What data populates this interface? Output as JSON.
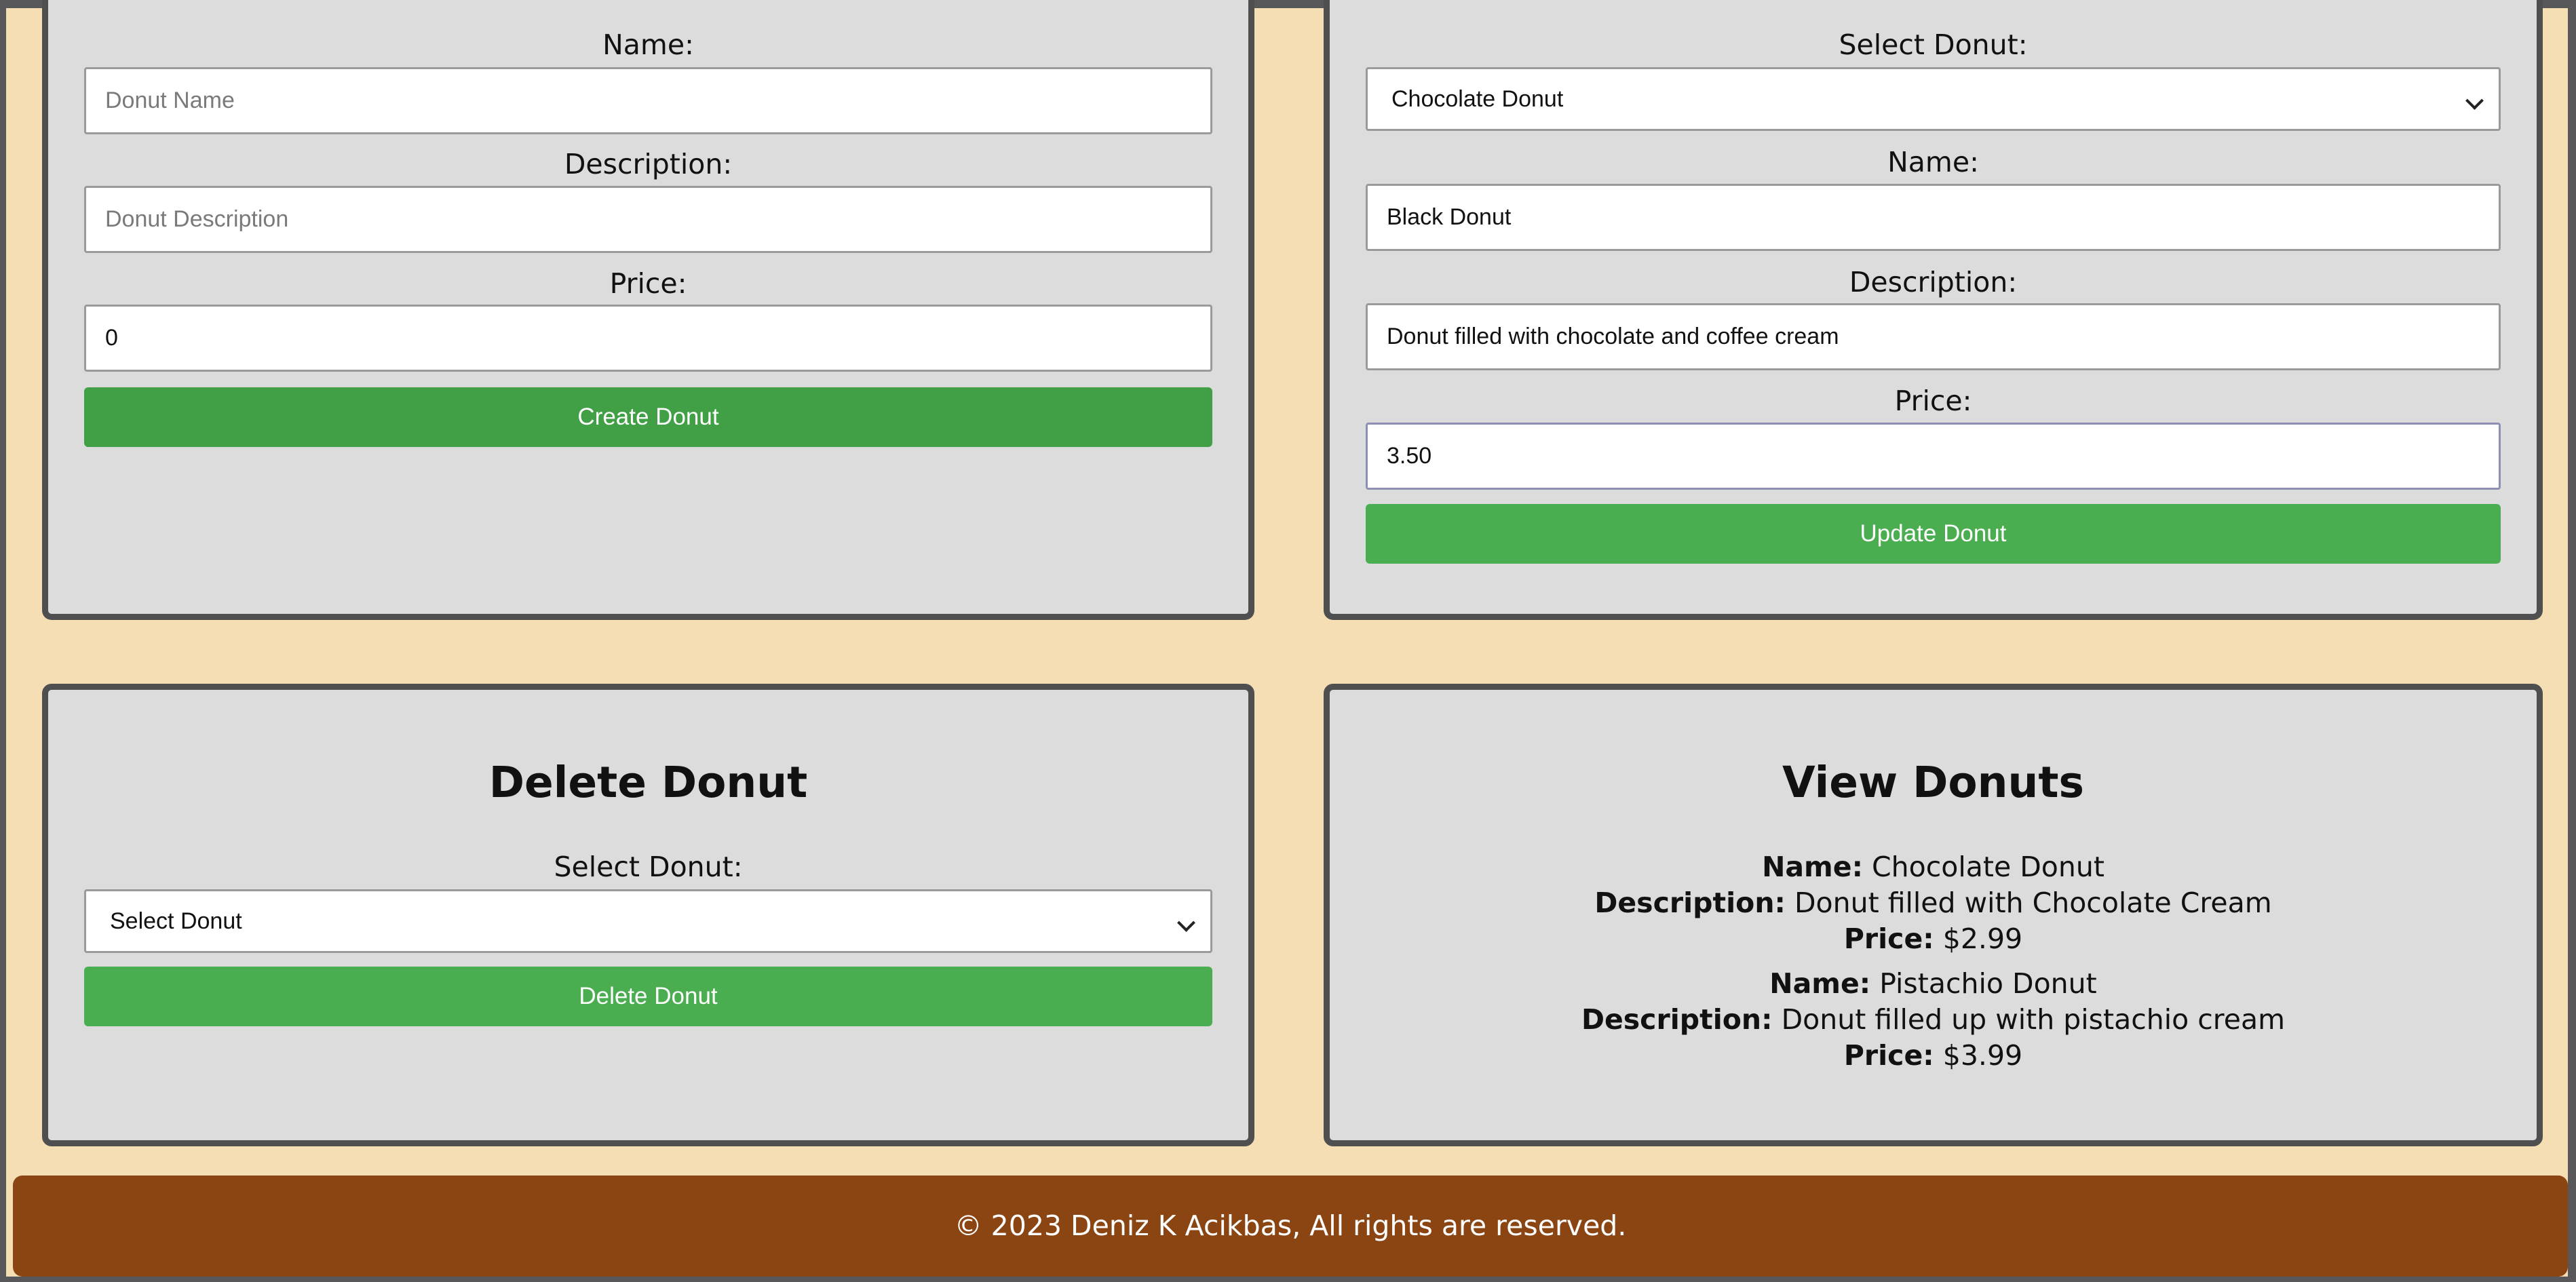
{
  "create": {
    "name_label": "Name:",
    "name_placeholder": "Donut Name",
    "description_label": "Description:",
    "description_placeholder": "Donut Description",
    "price_label": "Price:",
    "price_value": "0",
    "button": "Create Donut"
  },
  "update": {
    "select_label": "Select Donut:",
    "select_value": "Chocolate Donut",
    "name_label": "Name:",
    "name_value": "Black Donut",
    "description_label": "Description:",
    "description_value": "Donut filled with chocolate and coffee cream",
    "price_label": "Price:",
    "price_value": "3.50",
    "button": "Update Donut"
  },
  "delete": {
    "title": "Delete Donut",
    "select_label": "Select Donut:",
    "select_value": "Select Donut",
    "button": "Delete Donut"
  },
  "view": {
    "title": "View Donuts",
    "name_key": "Name:",
    "description_key": "Description:",
    "price_key": "Price:",
    "donuts": [
      {
        "name": "Chocolate Donut",
        "description": "Donut filled with Chocolate Cream",
        "price": "$2.99"
      },
      {
        "name": "Pistachio Donut",
        "description": "Donut filled up with pistachio cream",
        "price": "$3.99"
      }
    ]
  },
  "footer": {
    "text": "© 2023 Deniz K Acikbas, All rights are reserved."
  },
  "colors": {
    "page_background": "#f6deb4",
    "card_background": "#dcdcdc",
    "button_green": "#4aad50",
    "footer_brown": "#8b4512"
  }
}
